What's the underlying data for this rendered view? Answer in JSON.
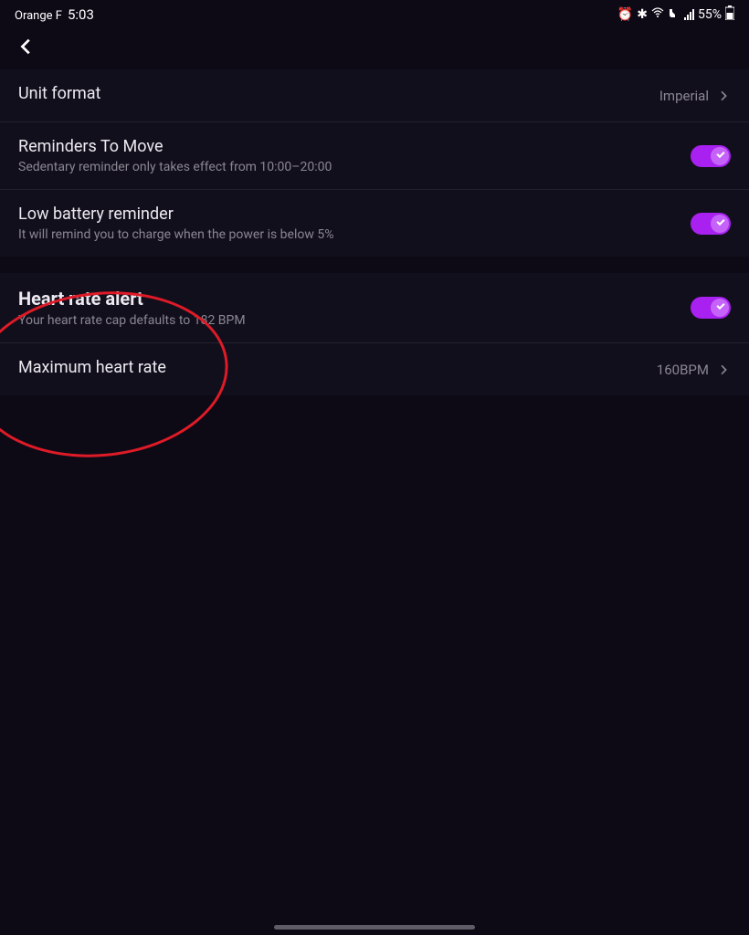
{
  "status": {
    "carrier": "Orange F",
    "time": "5:03",
    "battery": "55%"
  },
  "settings": {
    "unit_format": {
      "title": "Unit format",
      "value": "Imperial"
    },
    "reminders": {
      "title": "Reminders To Move",
      "sub": "Sedentary reminder only takes effect from 10:00–20:00",
      "enabled": true
    },
    "low_battery": {
      "title": "Low battery reminder",
      "sub": "It will remind you to charge when the power is below 5%",
      "enabled": true
    },
    "heart_alert": {
      "title": "Heart rate alert",
      "sub": "Your heart rate cap defaults to 182 BPM",
      "enabled": true
    },
    "max_hr": {
      "title": "Maximum heart rate",
      "value": "160BPM"
    }
  }
}
